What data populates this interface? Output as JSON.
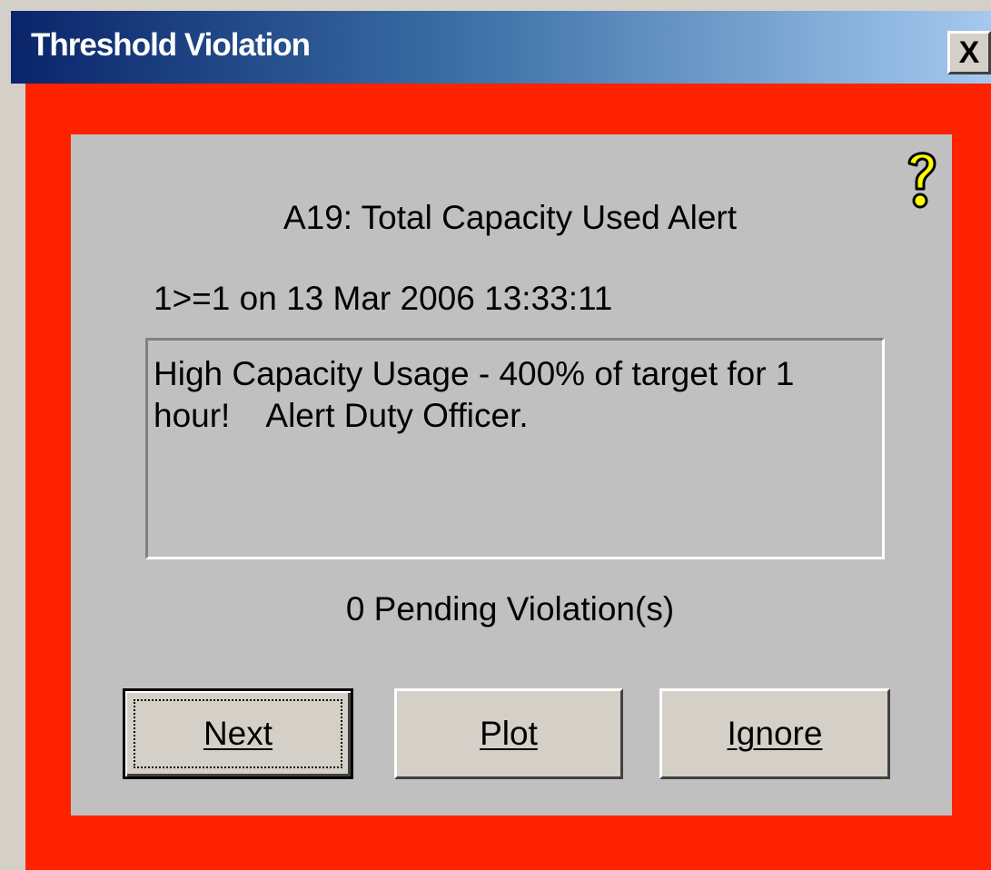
{
  "window": {
    "title": "Threshold Violation",
    "close_label": "X"
  },
  "dialog": {
    "alert_title": "A19: Total Capacity Used Alert",
    "violation_line": "1>=1 on 13 Mar 2006 13:33:11",
    "message": "High Capacity Usage - 400% of target for 1\nhour!    Alert Duty Officer.",
    "pending": "0  Pending Violation(s)"
  },
  "buttons": {
    "next": "Next",
    "plot": "Plot",
    "ignore": "Ignore"
  },
  "colors": {
    "alert_frame": "#ff2200",
    "panel": "#c0c0c0",
    "titlebar_start": "#0a246a",
    "titlebar_end": "#a6caf0",
    "help_icon": "#ffff00"
  },
  "icons": {
    "help": "help-question-icon",
    "close": "close-icon"
  }
}
